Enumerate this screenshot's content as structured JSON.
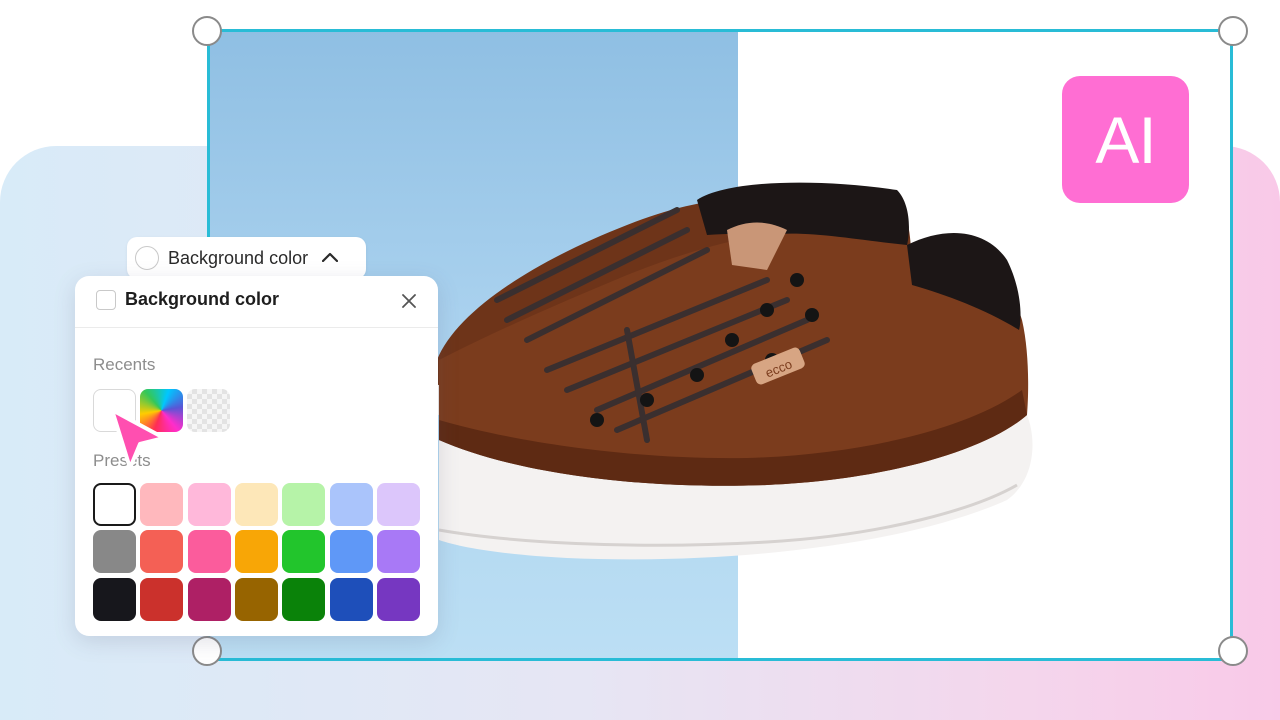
{
  "ai_badge": {
    "label": "AI",
    "color": "#ff6ed3"
  },
  "selection": {
    "border_color": "#29bcd6"
  },
  "canvas": {
    "left_bg_color": "#a9d1ee",
    "right_bg_color": "#ffffff",
    "shoe_brand_tag": "ecco"
  },
  "dropdown": {
    "label": "Background color",
    "chevron_icon": "chevron-up-icon"
  },
  "panel": {
    "title": "Background color",
    "close_icon": "close-icon",
    "recents_label": "Recents",
    "presets_label": "Presets",
    "recents": [
      {
        "name": "recent-white",
        "color": "#ffffff"
      },
      {
        "name": "recent-gradient",
        "color": "rainbow"
      },
      {
        "name": "recent-transparent",
        "color": "transparent"
      }
    ],
    "presets": [
      [
        "#ffffff",
        "#ffb8bd",
        "#ffb8da",
        "#fde7b8",
        "#b6f3a8",
        "#aac4fb",
        "#dcc6fb"
      ],
      [
        "#888888",
        "#f46055",
        "#fb5c9c",
        "#f8a606",
        "#22c52c",
        "#5f98f7",
        "#a879f6"
      ],
      [
        "#17171c",
        "#cb312c",
        "#ae2065",
        "#976400",
        "#0a8209",
        "#1e4fba",
        "#7637c1"
      ]
    ],
    "selected_preset": "#ffffff"
  },
  "cursor": {
    "color": "#ff4fb0"
  }
}
